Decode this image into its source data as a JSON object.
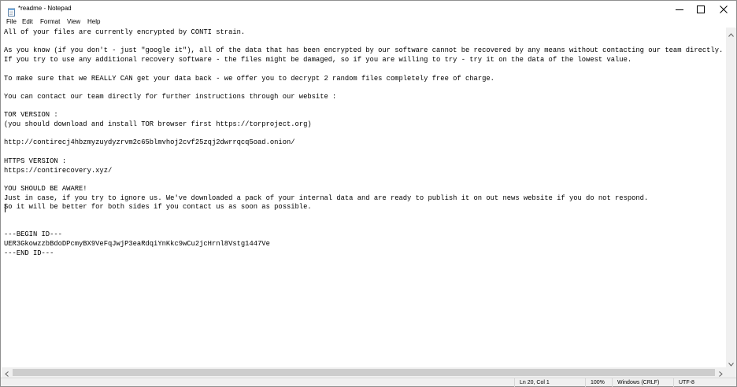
{
  "window": {
    "title": "*readme - Notepad",
    "icon": "notepad-icon"
  },
  "controls": {
    "minimize_icon": "minimize-icon",
    "maximize_icon": "maximize-icon",
    "close_icon": "close-icon"
  },
  "menu": {
    "items": [
      {
        "label": "File"
      },
      {
        "label": "Edit"
      },
      {
        "label": "Format"
      },
      {
        "label": "View"
      },
      {
        "label": "Help"
      }
    ]
  },
  "editor": {
    "content": "All of your files are currently encrypted by CONTI strain.\n\nAs you know (if you don't - just \"google it\"), all of the data that has been encrypted by our software cannot be recovered by any means without contacting our team directly.\nIf you try to use any additional recovery software - the files might be damaged, so if you are willing to try - try it on the data of the lowest value.\n\nTo make sure that we REALLY CAN get your data back - we offer you to decrypt 2 random files completely free of charge.\n\nYou can contact our team directly for further instructions through our website :\n\nTOR VERSION :\n(you should download and install TOR browser first https://torproject.org)\n\nhttp://contirecj4hbzmyzuydyzrvm2c65blmvhoj2cvf25zqj2dwrrqcq5oad.onion/\n\nHTTPS VERSION :\nhttps://contirecovery.xyz/\n\nYOU SHOULD BE AWARE!\nJust in case, if you try to ignore us. We've downloaded a pack of your internal data and are ready to publish it on out news website if you do not respond.\nSo it will be better for both sides if you contact us as soon as possible.\n\n\n---BEGIN ID---\nUER3GkowzzbBdoDPcmyBX9VeFqJwjP3eaRdqiYnKkc9wCu2jcHrnl8Vstg1447Ve\n---END ID---"
  },
  "statusbar": {
    "position": "Ln 20, Col 1",
    "zoom": "100%",
    "line_ending": "Windows (CRLF)",
    "encoding": "UTF-8"
  }
}
